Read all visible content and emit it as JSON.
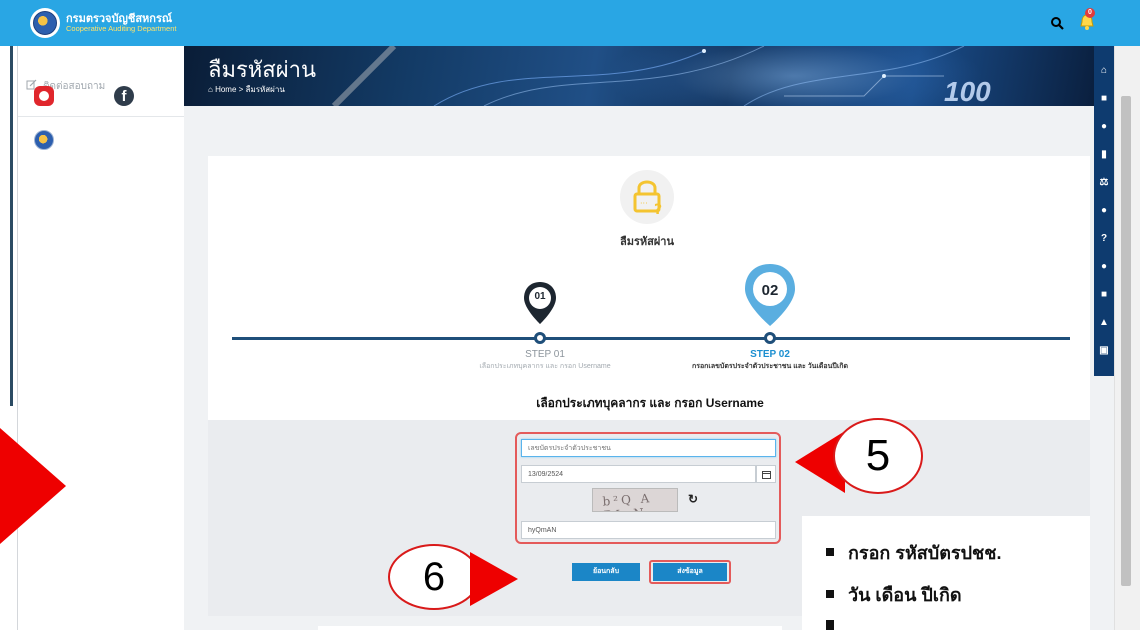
{
  "header": {
    "brand_th": "กรมตรวจบัญชีสหกรณ์",
    "brand_en": "Cooperative Auditing Department",
    "notification_count": "0"
  },
  "sidebar": {
    "contact_label": "ติดต่อสอบถาม"
  },
  "banner": {
    "title": "ลืมรหัสผ่าน",
    "breadcrumb": "Home > ลืมรหัสผ่าน",
    "decor_digits": "100"
  },
  "card": {
    "title": "ลืมรหัสผ่าน",
    "steps": [
      {
        "pin": "01",
        "label": "STEP 01",
        "desc": "เลือกประเภทบุคลากร และ กรอก Username"
      },
      {
        "pin": "02",
        "label": "STEP 02",
        "desc": "กรอกเลขบัตรประจำตัวประชาชน และ วันเดือนปีเกิด"
      }
    ],
    "form_heading": "เลือกประเภทบุคลากร และ กรอก Username"
  },
  "form": {
    "id_card_placeholder": "เลขบัตรประจำตัวประชาชน",
    "birth_date_value": "13/09/2524",
    "captcha_text": "b²Q A RL N",
    "captcha_input_value": "hyQmAN",
    "back_button": "ย้อนกลับ",
    "submit_button": "ส่งข้อมูล"
  },
  "annotations": {
    "step5": "5",
    "step6": "6",
    "notes": [
      "กรอก รหัสบัตรปชช.",
      "วัน เดือน ปีเกิด"
    ]
  },
  "colors": {
    "topbar": "#29a6e4",
    "accent_blue": "#1b86c7",
    "annotation_red": "#ee0000",
    "step_line": "#1f4f7a"
  }
}
